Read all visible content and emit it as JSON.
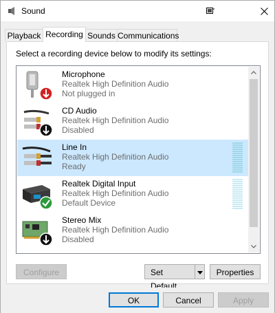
{
  "window": {
    "title": "Sound",
    "restore_icon": "window-restore-icon",
    "close_icon": "close-icon"
  },
  "tabs": [
    {
      "label": "Playback",
      "active": false
    },
    {
      "label": "Recording",
      "active": true
    },
    {
      "label": "Sounds",
      "active": false
    },
    {
      "label": "Communications",
      "active": false
    }
  ],
  "instruction": "Select a recording device below to modify its settings:",
  "devices": [
    {
      "name": "Microphone",
      "description": "Realtek High Definition Audio",
      "status": "Not plugged in",
      "icon": "microphone-icon",
      "badge": "red-down-arrow",
      "selected": false,
      "meter": "none"
    },
    {
      "name": "CD Audio",
      "description": "Realtek High Definition Audio",
      "status": "Disabled",
      "icon": "rca-cable-icon",
      "badge": "black-down-arrow",
      "selected": false,
      "meter": "none"
    },
    {
      "name": "Line In",
      "description": "Realtek High Definition Audio",
      "status": "Ready",
      "icon": "line-in-cable-icon",
      "badge": "none",
      "selected": true,
      "meter": "level"
    },
    {
      "name": "Realtek Digital Input",
      "description": "Realtek High Definition Audio",
      "status": "Default Device",
      "icon": "digital-input-icon",
      "badge": "green-check",
      "selected": false,
      "meter": "level"
    },
    {
      "name": "Stereo Mix",
      "description": "Realtek High Definition Audio",
      "status": "Disabled",
      "icon": "sound-card-icon",
      "badge": "black-down-arrow",
      "selected": false,
      "meter": "none"
    }
  ],
  "buttons": {
    "configure": "Configure",
    "set_default": "Set Default",
    "properties": "Properties",
    "ok": "OK",
    "cancel": "Cancel",
    "apply": "Apply"
  },
  "colors": {
    "selection": "#cce8ff",
    "accent": "#0078d7",
    "meter": "#9fd7e9"
  }
}
